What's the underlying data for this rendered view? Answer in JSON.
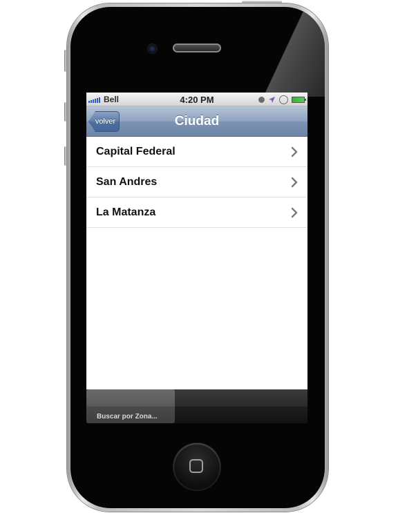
{
  "status_bar": {
    "carrier": "Bell",
    "time": "4:20 PM",
    "icons": [
      "signal-icon",
      "alarm-icon",
      "location-arrow-icon",
      "rotation-lock-icon",
      "battery-icon"
    ]
  },
  "nav_bar": {
    "back_label": "volver",
    "title": "Ciudad"
  },
  "list": {
    "items": [
      {
        "label": "Capital Federal"
      },
      {
        "label": "San Andres"
      },
      {
        "label": "La Matanza"
      }
    ]
  },
  "tab_bar": {
    "items": [
      {
        "label": "Buscar por Zona..."
      }
    ]
  },
  "colors": {
    "nav_blue": "#6d85a8",
    "tab_bar": "#1e1e1e",
    "battery_green": "#2fb52f",
    "signal_blue": "#2a5cb8"
  }
}
